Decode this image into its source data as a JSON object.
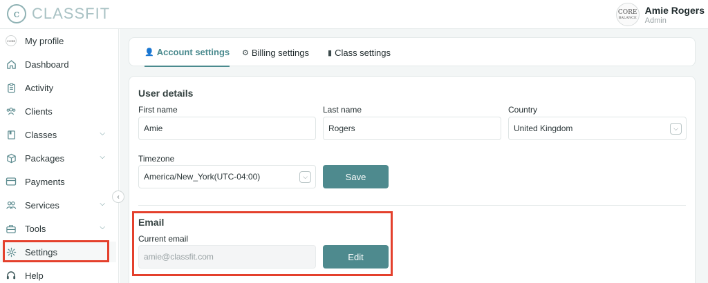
{
  "app": {
    "logo_mark": "c",
    "logo_text": "CLASSFIT"
  },
  "user": {
    "name": "Amie Rogers",
    "role": "Admin",
    "avatar_top": "CORE",
    "avatar_bottom": "BALANCE"
  },
  "sidebar": {
    "items": [
      {
        "label": "My profile",
        "icon": "profile-avatar"
      },
      {
        "label": "Dashboard",
        "icon": "home-icon"
      },
      {
        "label": "Activity",
        "icon": "clipboard-icon"
      },
      {
        "label": "Clients",
        "icon": "users-icon"
      },
      {
        "label": "Classes",
        "icon": "book-icon",
        "expandable": true
      },
      {
        "label": "Packages",
        "icon": "box-icon",
        "expandable": true
      },
      {
        "label": "Payments",
        "icon": "card-icon"
      },
      {
        "label": "Services",
        "icon": "people-icon",
        "expandable": true
      },
      {
        "label": "Tools",
        "icon": "toolbox-icon",
        "expandable": true
      },
      {
        "label": "Settings",
        "icon": "gear-icon",
        "active": true
      },
      {
        "label": "Help",
        "icon": "headset-icon"
      }
    ]
  },
  "tabs": [
    {
      "label": "Account settings",
      "active": true
    },
    {
      "label": "Billing settings"
    },
    {
      "label": "Class settings"
    }
  ],
  "user_details": {
    "title": "User details",
    "first_name": {
      "label": "First name",
      "value": "Amie"
    },
    "last_name": {
      "label": "Last name",
      "value": "Rogers"
    },
    "country": {
      "label": "Country",
      "value": "United Kingdom"
    },
    "timezone": {
      "label": "Timezone",
      "value": "America/New_York(UTC-04:00)"
    },
    "save_label": "Save"
  },
  "email": {
    "title": "Email",
    "current_label": "Current email",
    "current_value": "amie@classfit.com",
    "edit_label": "Edit"
  },
  "colors": {
    "accent": "#4e8a8e",
    "highlight": "#e4402c"
  }
}
